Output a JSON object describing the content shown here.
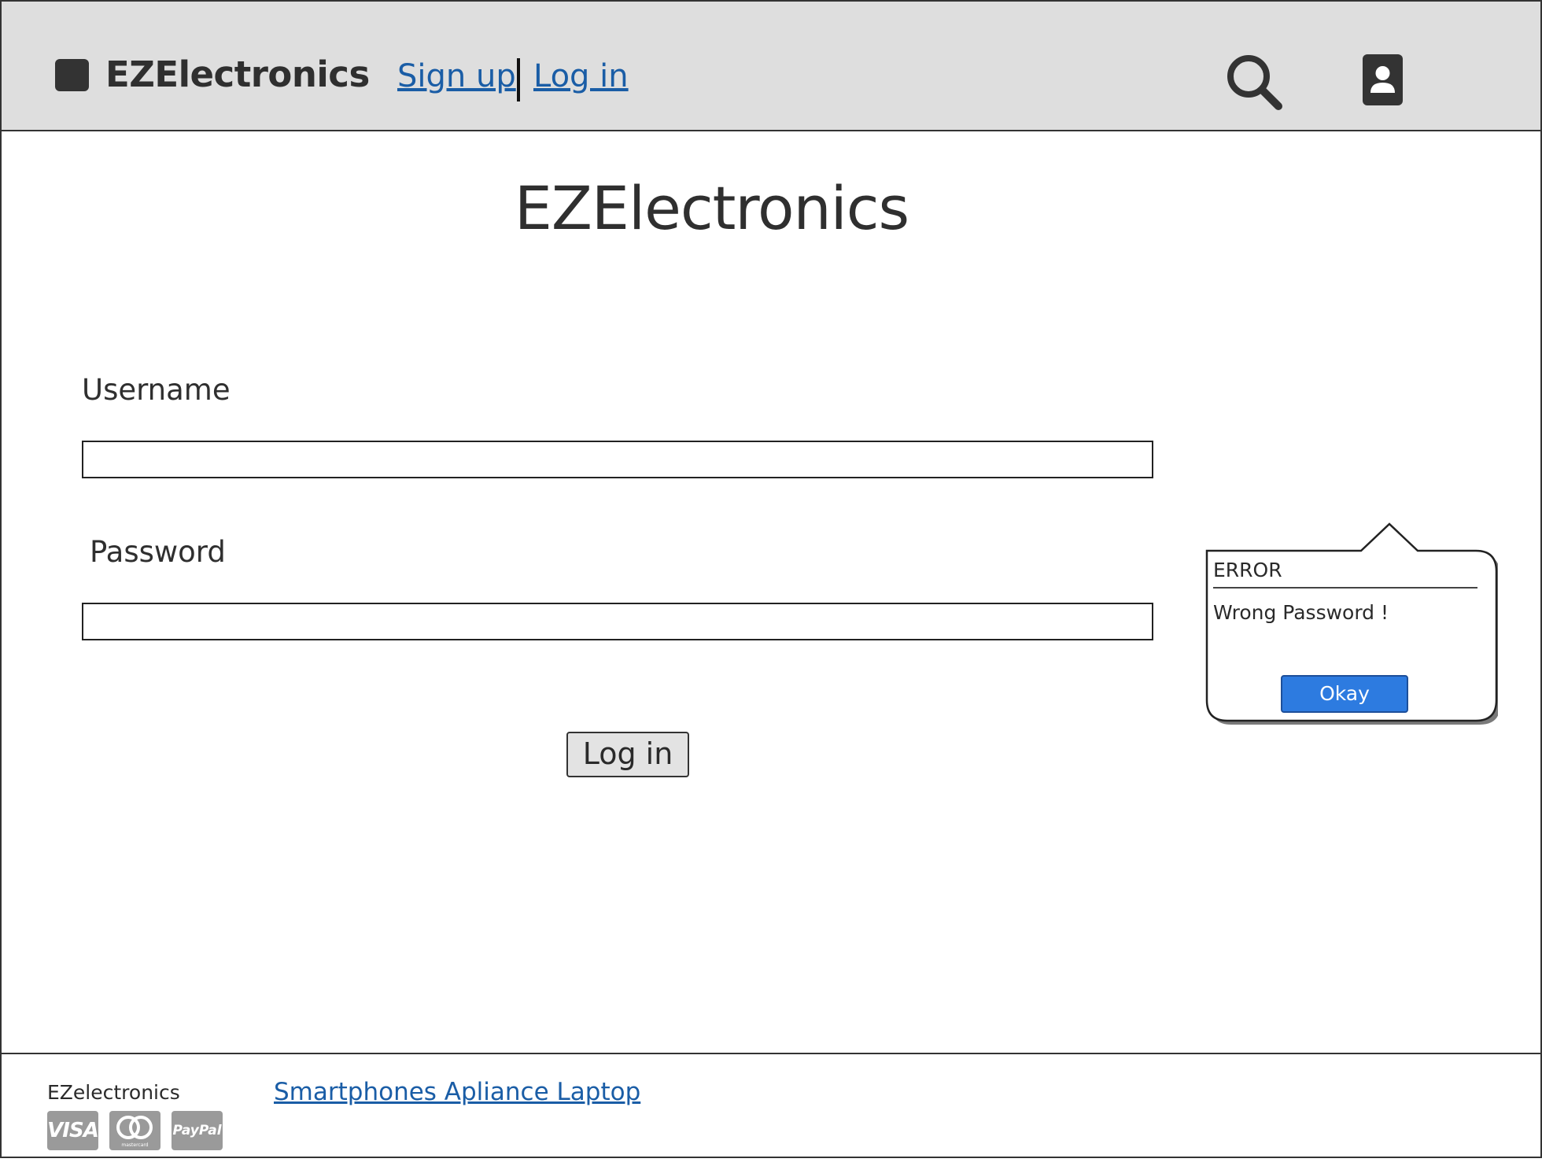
{
  "header": {
    "brand": "EZElectronics",
    "signup_label": "Sign up",
    "login_label": "Log in"
  },
  "main": {
    "title": "EZElectronics",
    "username_label": "Username",
    "username_value": "",
    "password_label": "Password",
    "password_value": "",
    "login_button_label": "Log in"
  },
  "error_popup": {
    "title": "ERROR",
    "message": "Wrong Password !",
    "okay_label": "Okay"
  },
  "footer": {
    "brand": "EZelectronics",
    "links": "Smartphones Apliance Laptop",
    "payment": {
      "visa": "VISA",
      "mastercard": "mastercard",
      "paypal": "PayPal"
    }
  },
  "colors": {
    "header_bg": "#dedede",
    "link": "#1a5da6",
    "okay_button": "#2d7be0",
    "badge": "#9a9a9a"
  },
  "icons": [
    "logo-square-icon",
    "search-icon",
    "user-icon",
    "visa-icon",
    "mastercard-icon",
    "paypal-icon"
  ]
}
